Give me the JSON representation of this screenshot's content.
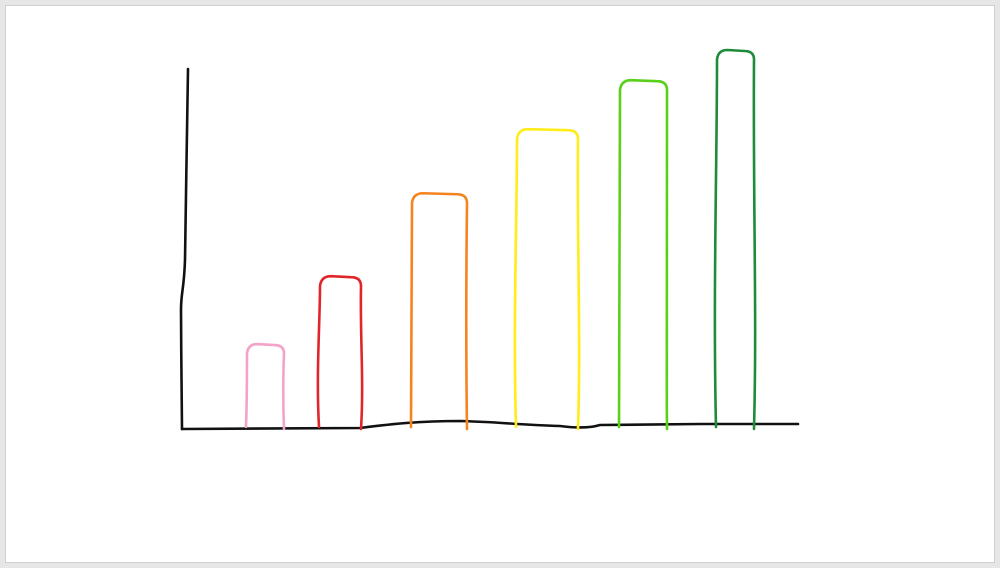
{
  "colors": {
    "canvas_border": "#d0d0d0",
    "axis": "#111111"
  },
  "chart_data": {
    "type": "bar",
    "hand_drawn": true,
    "title": "",
    "xlabel": "",
    "ylabel": "",
    "grid": false,
    "legend": "none",
    "ylim": [
      0,
      1
    ],
    "tick_labels": "none",
    "series": [
      {
        "values": [
          0.22,
          0.4,
          0.62,
          0.79,
          0.92,
          1.0
        ],
        "colors": [
          "#f4a3c8",
          "#e0262b",
          "#f5841f",
          "#ffec1a",
          "#59d119",
          "#1e8a3a"
        ]
      }
    ]
  }
}
